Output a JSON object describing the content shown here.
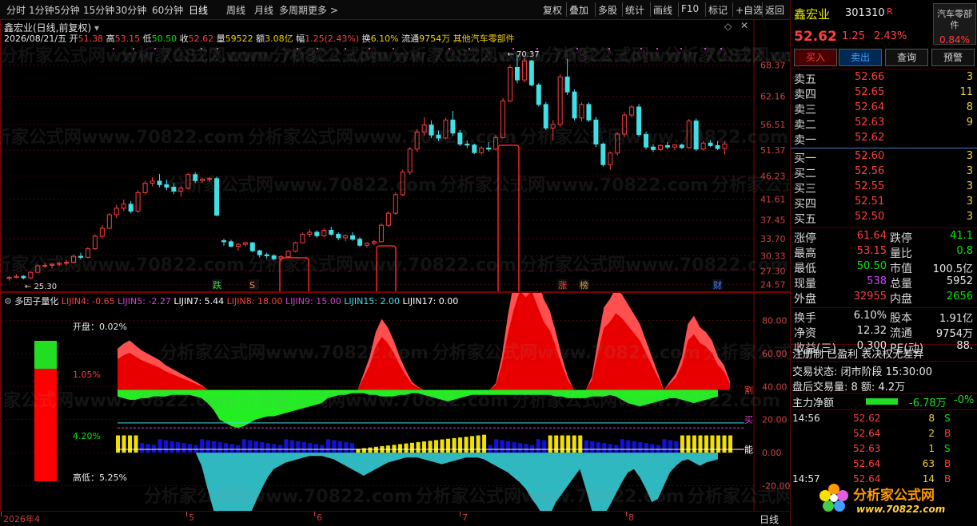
{
  "toolbar": {
    "periods": [
      "分时",
      "1分钟",
      "5分钟",
      "15分钟",
      "30分钟",
      "60分钟",
      "日线",
      "周线",
      "月线",
      "多周期",
      "更多 >"
    ],
    "active": "日线",
    "right_buttons": [
      "复权",
      "叠加",
      "多股",
      "统计",
      "画线",
      "F10",
      "标记",
      "+自选",
      "返回"
    ]
  },
  "main": {
    "title": "鑫宏业(日线,前复权)",
    "date": "2026/08/21/五",
    "open_label": "开",
    "open": "51.38",
    "high_label": "高",
    "high": "53.15",
    "low_label": "低",
    "low": "50.50",
    "close_label": "收",
    "close": "52.62",
    "vol_label": "量",
    "vol": "59522",
    "amount_label": "额",
    "amount": "3.08亿",
    "chg_label": "幅",
    "chg": "1.25(2.43%)",
    "turnover_label": "换",
    "turnover": "6.10%",
    "float_label": "流通",
    "float": "9754万",
    "sector": "其他汽车零部件",
    "y_ticks": [
      "68.37",
      "62.16",
      "56.51",
      "51.37",
      "46.23",
      "41.61",
      "37.45",
      "33.70",
      "30.33",
      "27.30",
      "24.57"
    ],
    "high_marker": "70.37",
    "low_marker": "25.30",
    "event_markers": [
      "跌",
      "S",
      "涨",
      "榜",
      "财"
    ]
  },
  "indicator": {
    "title": "多因子量化",
    "params": [
      {
        "label": "LIJIN4: -0.65",
        "color": "#ff3d3d"
      },
      {
        "label": "LIJIN5: -2.27",
        "color": "#d040d0"
      },
      {
        "label": "LIJIN7: 5.44",
        "color": "#ffffff"
      },
      {
        "label": "LIJIN8: 18.00",
        "color": "#ff3d3d"
      },
      {
        "label": "LIJIN9: 15.00",
        "color": "#d040d0"
      },
      {
        "label": "LIJIN15: 2.00",
        "color": "#40e0e8"
      },
      {
        "label": "LIJIN17: 0.00",
        "color": "#ffffff"
      }
    ],
    "y_ticks": [
      "80.00",
      "60.00",
      "40.00",
      "20.00",
      "0.00",
      "-20.00"
    ],
    "line_labels": [
      "割",
      "买",
      "能"
    ],
    "open_text": "开盘：0.02%",
    "mid_text_top": "1.05%",
    "mid_text_bottom": "4.20%",
    "hilo_text": "高低：5.25%",
    "bar_top_ratio": 0.2,
    "bar_bottom_ratio": 0.8
  },
  "bottom_axis": {
    "labels": [
      "2026年4",
      "5",
      "6",
      "7",
      "8"
    ],
    "mode": "日线"
  },
  "watermarks": [
    "分析家公式网www.70822.com"
  ],
  "right": {
    "name": "鑫宏业",
    "code": "301310",
    "flag": "R",
    "sector_tag": "汽车零部件",
    "sector_chg": "0.84%",
    "price": "52.62",
    "change": "1.25",
    "pct": "2.43%",
    "buttons": [
      "买入",
      "卖出",
      "查询",
      "预警"
    ],
    "asks": [
      {
        "label": "卖五",
        "price": "52.66",
        "vol": "3"
      },
      {
        "label": "卖四",
        "price": "52.65",
        "vol": "11"
      },
      {
        "label": "卖三",
        "price": "52.64",
        "vol": "8"
      },
      {
        "label": "卖二",
        "price": "52.63",
        "vol": "9"
      },
      {
        "label": "卖一",
        "price": "52.62",
        "vol": ""
      }
    ],
    "bids": [
      {
        "label": "买一",
        "price": "52.60",
        "vol": "3"
      },
      {
        "label": "买二",
        "price": "52.56",
        "vol": "3"
      },
      {
        "label": "买三",
        "price": "52.55",
        "vol": "3"
      },
      {
        "label": "买四",
        "price": "52.51",
        "vol": "3"
      },
      {
        "label": "买五",
        "price": "52.50",
        "vol": "3"
      }
    ],
    "stats": [
      {
        "l1": "涨停",
        "v1": "61.64",
        "c1": "red",
        "l2": "跌停",
        "v2": "41.1",
        "c2": "green"
      },
      {
        "l1": "最高",
        "v1": "53.15",
        "c1": "red",
        "l2": "量比",
        "v2": "0.8",
        "c2": "green"
      },
      {
        "l1": "最低",
        "v1": "50.50",
        "c1": "green",
        "l2": "市值",
        "v2": "100.5亿",
        "c2": "white"
      },
      {
        "l1": "现量",
        "v1": "538",
        "c1": "purple",
        "l2": "总量",
        "v2": "5952",
        "c2": "white"
      },
      {
        "l1": "外盘",
        "v1": "32955",
        "c1": "red",
        "l2": "内盘",
        "v2": "2656",
        "c2": "green"
      }
    ],
    "fin": [
      {
        "l1": "换手",
        "v1": "6.10%",
        "l2": "股本",
        "v2": "1.91亿"
      },
      {
        "l1": "净资",
        "v1": "12.32",
        "l2": "流通",
        "v2": "9754万"
      },
      {
        "l1": "收益(三)",
        "v1": "0.300",
        "l2": "PE(动)",
        "v2": "88."
      }
    ],
    "tags": "注册制 已盈利 表决权无差异",
    "trade_status": "交易状态: 闭市阶段 15:30:00",
    "after_hours": "盘后交易量: 8  额: 4.2万",
    "main_flow_label": "主力净额",
    "main_flow": "-6.78万",
    "main_flow_pct": "-0%",
    "ticks": [
      {
        "time": "14:56",
        "price": "52.62",
        "vol": "8",
        "side": "S"
      },
      {
        "time": "",
        "price": "52.64",
        "vol": "2",
        "side": "B"
      },
      {
        "time": "",
        "price": "52.63",
        "vol": "1",
        "side": "S"
      },
      {
        "time": "",
        "price": "52.64",
        "vol": "63",
        "side": "B"
      },
      {
        "time": "14:57",
        "price": "52.64",
        "vol": "14",
        "side": "B"
      }
    ],
    "logo_text": "分析家公式网",
    "logo_url": "www.70822.com"
  },
  "chart_data": {
    "type": "candlestick",
    "ylim": [
      24.0,
      71.0
    ],
    "candles": [
      [
        25.8,
        26.3,
        25.3,
        26.0
      ],
      [
        26.0,
        26.6,
        25.8,
        26.2
      ],
      [
        26.2,
        26.4,
        25.6,
        25.9
      ],
      [
        25.9,
        27.2,
        25.7,
        27.0
      ],
      [
        27.0,
        28.6,
        26.9,
        28.3
      ],
      [
        28.3,
        28.9,
        27.9,
        28.4
      ],
      [
        28.4,
        28.8,
        27.8,
        28.6
      ],
      [
        28.6,
        29.1,
        28.2,
        28.8
      ],
      [
        28.8,
        29.4,
        28.4,
        29.0
      ],
      [
        29.0,
        30.6,
        28.8,
        30.2
      ],
      [
        30.2,
        30.9,
        29.6,
        30.0
      ],
      [
        30.0,
        32.0,
        29.8,
        31.7
      ],
      [
        31.7,
        34.6,
        31.5,
        34.2
      ],
      [
        34.2,
        36.4,
        33.8,
        35.8
      ],
      [
        35.8,
        38.8,
        35.6,
        38.5
      ],
      [
        38.5,
        40.5,
        37.8,
        39.8
      ],
      [
        39.8,
        41.5,
        39.2,
        40.6
      ],
      [
        40.6,
        41.2,
        38.8,
        39.2
      ],
      [
        39.2,
        43.4,
        38.9,
        42.9
      ],
      [
        42.9,
        45.3,
        42.5,
        44.8
      ],
      [
        44.8,
        46.0,
        44.2,
        45.2
      ],
      [
        45.2,
        46.6,
        44.0,
        44.5
      ],
      [
        44.5,
        45.5,
        43.4,
        44.0
      ],
      [
        44.0,
        44.8,
        42.6,
        43.2
      ],
      [
        43.2,
        44.2,
        42.1,
        43.8
      ],
      [
        43.8,
        46.9,
        43.5,
        46.5
      ],
      [
        46.5,
        47.0,
        44.8,
        45.3
      ],
      [
        45.3,
        45.9,
        44.9,
        45.6
      ],
      [
        45.6,
        46.0,
        45.0,
        45.7
      ],
      [
        45.7,
        46.1,
        38.2,
        38.4
      ],
      [
        33.3,
        33.7,
        32.3,
        33.1
      ],
      [
        33.1,
        33.5,
        32.0,
        32.2
      ],
      [
        32.2,
        32.8,
        31.3,
        32.6
      ],
      [
        32.6,
        33.1,
        32.2,
        32.9
      ],
      [
        32.9,
        33.0,
        31.0,
        31.3
      ],
      [
        31.3,
        31.5,
        30.0,
        30.5
      ],
      [
        30.5,
        30.9,
        29.7,
        30.3
      ],
      [
        30.3,
        30.6,
        29.4,
        29.7
      ],
      [
        29.7,
        30.4,
        29.2,
        30.1
      ],
      [
        30.1,
        31.4,
        29.9,
        31.2
      ],
      [
        31.2,
        33.1,
        31.0,
        32.9
      ],
      [
        32.9,
        34.9,
        32.8,
        34.6
      ],
      [
        34.6,
        35.6,
        34.0,
        35.0
      ],
      [
        35.0,
        35.4,
        33.9,
        34.3
      ],
      [
        34.3,
        35.8,
        34.0,
        35.4
      ],
      [
        35.4,
        36.1,
        34.3,
        34.6
      ],
      [
        34.6,
        35.0,
        33.4,
        33.9
      ],
      [
        33.9,
        34.6,
        33.2,
        34.3
      ],
      [
        34.3,
        35.0,
        33.3,
        33.6
      ],
      [
        33.6,
        34.0,
        32.1,
        32.4
      ],
      [
        32.4,
        33.0,
        31.9,
        32.8
      ],
      [
        32.8,
        33.4,
        32.4,
        33.1
      ],
      [
        33.1,
        36.8,
        33.0,
        36.4
      ],
      [
        36.4,
        39.2,
        36.0,
        38.8
      ],
      [
        38.8,
        43.0,
        38.5,
        42.5
      ],
      [
        42.5,
        47.5,
        42.2,
        47.0
      ],
      [
        47.0,
        52.0,
        46.5,
        51.6
      ],
      [
        51.6,
        55.6,
        51.0,
        55.0
      ],
      [
        55.0,
        58.0,
        54.3,
        56.4
      ],
      [
        56.4,
        57.3,
        53.8,
        54.4
      ],
      [
        54.4,
        55.3,
        53.2,
        53.8
      ],
      [
        53.8,
        57.9,
        53.5,
        57.4
      ],
      [
        57.4,
        59.2,
        54.3,
        54.8
      ],
      [
        54.8,
        55.4,
        52.2,
        52.6
      ],
      [
        52.6,
        53.3,
        51.8,
        52.4
      ],
      [
        52.4,
        52.7,
        50.6,
        50.9
      ],
      [
        50.9,
        52.2,
        50.5,
        51.8
      ],
      [
        51.8,
        53.0,
        51.1,
        51.6
      ],
      [
        51.6,
        54.4,
        51.3,
        53.9
      ],
      [
        53.9,
        61.8,
        53.7,
        61.2
      ],
      [
        61.2,
        68.4,
        61.0,
        67.9
      ],
      [
        67.9,
        70.4,
        64.7,
        65.4
      ],
      [
        65.4,
        69.8,
        64.9,
        69.2
      ],
      [
        69.2,
        69.4,
        64.1,
        64.4
      ],
      [
        64.4,
        64.8,
        60.1,
        60.5
      ],
      [
        60.5,
        61.0,
        55.4,
        55.8
      ],
      [
        55.8,
        57.4,
        53.3,
        56.5
      ],
      [
        56.5,
        66.5,
        56.0,
        66.0
      ],
      [
        66.0,
        69.6,
        62.4,
        63.0
      ],
      [
        63.0,
        63.5,
        57.3,
        57.8
      ],
      [
        57.8,
        60.9,
        57.2,
        60.5
      ],
      [
        60.5,
        60.9,
        57.0,
        57.4
      ],
      [
        57.4,
        58.0,
        52.0,
        52.6
      ],
      [
        52.6,
        52.9,
        48.1,
        48.5
      ],
      [
        48.5,
        51.1,
        47.5,
        50.8
      ],
      [
        50.8,
        55.0,
        50.3,
        54.6
      ],
      [
        54.6,
        58.9,
        54.0,
        58.4
      ],
      [
        58.4,
        60.4,
        57.9,
        60.0
      ],
      [
        60.0,
        60.6,
        54.1,
        54.5
      ],
      [
        54.5,
        55.1,
        51.5,
        52.0
      ],
      [
        52.0,
        52.6,
        51.0,
        51.5
      ],
      [
        51.5,
        52.6,
        51.2,
        52.3
      ],
      [
        52.3,
        53.0,
        51.6,
        52.0
      ],
      [
        52.0,
        52.6,
        51.4,
        52.4
      ],
      [
        52.4,
        52.7,
        51.6,
        51.9
      ],
      [
        51.9,
        57.6,
        51.7,
        57.2
      ],
      [
        57.2,
        57.7,
        51.2,
        51.6
      ],
      [
        51.6,
        53.2,
        51.3,
        52.8
      ],
      [
        52.8,
        53.4,
        52.0,
        52.3
      ],
      [
        52.3,
        53.2,
        51.4,
        51.7
      ],
      [
        51.7,
        53.15,
        50.5,
        52.62
      ]
    ],
    "indicator_ylim": [
      -28,
      90
    ],
    "red_area": [
      25,
      28,
      30,
      27,
      24,
      22,
      20,
      18,
      15,
      13,
      11,
      9,
      7,
      5,
      3,
      0,
      0,
      -2,
      -4,
      -6,
      -8,
      -10,
      -12,
      -14,
      -16,
      -18,
      -20,
      -22,
      -24,
      -26,
      -27,
      -29,
      -31,
      -33,
      -35,
      -33,
      -30,
      -25,
      -18,
      -8,
      0,
      10,
      20,
      35,
      43,
      38,
      30,
      20,
      12,
      5,
      2,
      0,
      -2,
      -4,
      -6,
      -8,
      -10,
      -12,
      -15,
      -18,
      -20,
      -14,
      -6,
      4,
      20,
      45,
      65,
      80,
      75,
      80,
      67,
      55,
      48,
      35,
      20,
      8,
      0,
      0,
      0,
      8,
      30,
      50,
      55,
      62,
      58,
      52,
      46,
      40,
      30,
      20,
      10,
      0,
      5,
      10,
      20,
      40,
      45,
      38,
      35,
      30,
      20,
      15,
      5
    ],
    "green_area": [
      -4,
      -5,
      -6,
      -6,
      -5,
      -5,
      -4,
      -4,
      -4,
      -3,
      -3,
      -3,
      -3,
      -4,
      -5,
      -8,
      -12,
      -18,
      -20,
      -22,
      -23,
      -22,
      -20,
      -18,
      -17,
      -16,
      -16,
      -15,
      -14,
      -13,
      -12,
      -11,
      -10,
      -9,
      -8,
      -5,
      -4,
      -3,
      -3,
      -2,
      -2,
      -2,
      -3,
      -3,
      -4,
      -4,
      -4,
      -3,
      -3,
      -2,
      -2,
      -3,
      -4,
      -5,
      -6,
      -7,
      -6,
      -5,
      -4,
      -3,
      -3,
      -3,
      -3,
      -3,
      -3,
      -3,
      -3,
      -3,
      -3,
      -3,
      -3,
      -3,
      -3,
      -4,
      -4,
      -5,
      -5,
      -5,
      -5,
      -4,
      -4,
      -4,
      -3,
      -4,
      -6,
      -8,
      -9,
      -10,
      -9,
      -8,
      -7,
      -6,
      -5,
      -5,
      -6,
      -7,
      -8,
      -7,
      -6,
      -5,
      -4
    ],
    "cyan_area": [
      0,
      0,
      0,
      0,
      0,
      0,
      0,
      0,
      0,
      0,
      0,
      0,
      0,
      0,
      -8,
      -22,
      -35,
      -48,
      -52,
      -55,
      -50,
      -45,
      -38,
      -30,
      -22,
      -15,
      -10,
      -8,
      -6,
      -5,
      -4,
      -3,
      -2,
      -2,
      -2,
      -3,
      -4,
      -6,
      -8,
      -10,
      -12,
      -14,
      -12,
      -10,
      -8,
      -6,
      -5,
      -4,
      -3,
      -3,
      -3,
      -4,
      -5,
      -6,
      -7,
      -6,
      -5,
      -4,
      -3,
      -3,
      -3,
      -4,
      -6,
      -8,
      -10,
      -12,
      -15,
      -18,
      -22,
      -28,
      -33,
      -40,
      -38,
      -30,
      -25,
      -20,
      -15,
      -10,
      -22,
      -35,
      -40,
      -38,
      -32,
      -25,
      -18,
      -12,
      -10,
      -15,
      -22,
      -30,
      -28,
      -20,
      -12,
      -8,
      -5,
      -4,
      -6,
      -8,
      -6,
      -5,
      -4
    ]
  }
}
